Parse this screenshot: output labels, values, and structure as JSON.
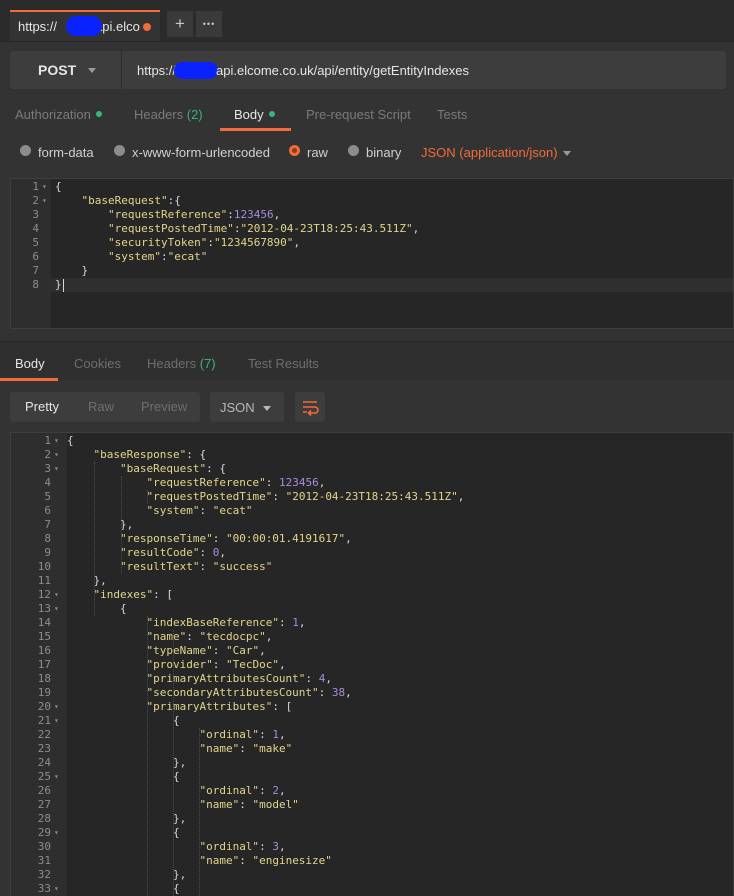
{
  "tab": {
    "title_prefix": "https://",
    "title_suffix": "api.elco",
    "new_tab": "+",
    "more": "•••"
  },
  "request": {
    "method": "POST",
    "url_prefix": "https://",
    "url_suffix": "api.elcome.co.uk/api/entity/getEntityIndexes"
  },
  "request_tabs": [
    {
      "label": "Authorization",
      "has_dot": true
    },
    {
      "label": "Headers",
      "count": "(2)"
    },
    {
      "label": "Body",
      "has_dot": true,
      "active": true
    },
    {
      "label": "Pre-request Script"
    },
    {
      "label": "Tests"
    }
  ],
  "body_options": {
    "modes": [
      "form-data",
      "x-www-form-urlencoded",
      "raw",
      "binary"
    ],
    "selected": "raw",
    "content_type": "JSON (application/json)"
  },
  "request_body": [
    [
      [
        "p",
        "{"
      ]
    ],
    [
      [
        "p",
        "    "
      ],
      [
        "k",
        "\"baseRequest\""
      ],
      [
        "p",
        ":{"
      ]
    ],
    [
      [
        "p",
        "        "
      ],
      [
        "k",
        "\"requestReference\""
      ],
      [
        "p",
        ":"
      ],
      [
        "n",
        "123456"
      ],
      [
        "p",
        ","
      ]
    ],
    [
      [
        "p",
        "        "
      ],
      [
        "k",
        "\"requestPostedTime\""
      ],
      [
        "p",
        ":"
      ],
      [
        "s",
        "\"2012-04-23T18:25:43.511Z\""
      ],
      [
        "p",
        ","
      ]
    ],
    [
      [
        "p",
        "        "
      ],
      [
        "k",
        "\"securityToken\""
      ],
      [
        "p",
        ":"
      ],
      [
        "s",
        "\"1234567890\""
      ],
      [
        "p",
        ","
      ]
    ],
    [
      [
        "p",
        "        "
      ],
      [
        "k",
        "\"system\""
      ],
      [
        "p",
        ":"
      ],
      [
        "s",
        "\"ecat\""
      ]
    ],
    [
      [
        "p",
        "    }"
      ]
    ],
    [
      [
        "p",
        "}"
      ]
    ]
  ],
  "request_folds": [
    1,
    2
  ],
  "response_tabs": [
    {
      "label": "Body",
      "active": true
    },
    {
      "label": "Cookies"
    },
    {
      "label": "Headers",
      "count": "(7)"
    },
    {
      "label": "Test Results"
    }
  ],
  "view_modes": [
    "Pretty",
    "Raw",
    "Preview"
  ],
  "view_selected": "Pretty",
  "format": "JSON",
  "response_body": [
    [
      [
        "p",
        "{"
      ]
    ],
    [
      [
        "p",
        "    "
      ],
      [
        "k",
        "\"baseResponse\""
      ],
      [
        "p",
        ": {"
      ]
    ],
    [
      [
        "p",
        "        "
      ],
      [
        "k",
        "\"baseRequest\""
      ],
      [
        "p",
        ": {"
      ]
    ],
    [
      [
        "p",
        "            "
      ],
      [
        "k",
        "\"requestReference\""
      ],
      [
        "p",
        ": "
      ],
      [
        "n",
        "123456"
      ],
      [
        "p",
        ","
      ]
    ],
    [
      [
        "p",
        "            "
      ],
      [
        "k",
        "\"requestPostedTime\""
      ],
      [
        "p",
        ": "
      ],
      [
        "s",
        "\"2012-04-23T18:25:43.511Z\""
      ],
      [
        "p",
        ","
      ]
    ],
    [
      [
        "p",
        "            "
      ],
      [
        "k",
        "\"system\""
      ],
      [
        "p",
        ": "
      ],
      [
        "s",
        "\"ecat\""
      ]
    ],
    [
      [
        "p",
        "        },"
      ]
    ],
    [
      [
        "p",
        "        "
      ],
      [
        "k",
        "\"responseTime\""
      ],
      [
        "p",
        ": "
      ],
      [
        "s",
        "\"00:00:01.4191617\""
      ],
      [
        "p",
        ","
      ]
    ],
    [
      [
        "p",
        "        "
      ],
      [
        "k",
        "\"resultCode\""
      ],
      [
        "p",
        ": "
      ],
      [
        "n",
        "0"
      ],
      [
        "p",
        ","
      ]
    ],
    [
      [
        "p",
        "        "
      ],
      [
        "k",
        "\"resultText\""
      ],
      [
        "p",
        ": "
      ],
      [
        "s",
        "\"success\""
      ]
    ],
    [
      [
        "p",
        "    },"
      ]
    ],
    [
      [
        "p",
        "    "
      ],
      [
        "k",
        "\"indexes\""
      ],
      [
        "p",
        ": ["
      ]
    ],
    [
      [
        "p",
        "        {"
      ]
    ],
    [
      [
        "p",
        "            "
      ],
      [
        "k",
        "\"indexBaseReference\""
      ],
      [
        "p",
        ": "
      ],
      [
        "n",
        "1"
      ],
      [
        "p",
        ","
      ]
    ],
    [
      [
        "p",
        "            "
      ],
      [
        "k",
        "\"name\""
      ],
      [
        "p",
        ": "
      ],
      [
        "s",
        "\"tecdocpc\""
      ],
      [
        "p",
        ","
      ]
    ],
    [
      [
        "p",
        "            "
      ],
      [
        "k",
        "\"typeName\""
      ],
      [
        "p",
        ": "
      ],
      [
        "s",
        "\"Car\""
      ],
      [
        "p",
        ","
      ]
    ],
    [
      [
        "p",
        "            "
      ],
      [
        "k",
        "\"provider\""
      ],
      [
        "p",
        ": "
      ],
      [
        "s",
        "\"TecDoc\""
      ],
      [
        "p",
        ","
      ]
    ],
    [
      [
        "p",
        "            "
      ],
      [
        "k",
        "\"primaryAttributesCount\""
      ],
      [
        "p",
        ": "
      ],
      [
        "n",
        "4"
      ],
      [
        "p",
        ","
      ]
    ],
    [
      [
        "p",
        "            "
      ],
      [
        "k",
        "\"secondaryAttributesCount\""
      ],
      [
        "p",
        ": "
      ],
      [
        "n",
        "38"
      ],
      [
        "p",
        ","
      ]
    ],
    [
      [
        "p",
        "            "
      ],
      [
        "k",
        "\"primaryAttributes\""
      ],
      [
        "p",
        ": ["
      ]
    ],
    [
      [
        "p",
        "                {"
      ]
    ],
    [
      [
        "p",
        "                    "
      ],
      [
        "k",
        "\"ordinal\""
      ],
      [
        "p",
        ": "
      ],
      [
        "n",
        "1"
      ],
      [
        "p",
        ","
      ]
    ],
    [
      [
        "p",
        "                    "
      ],
      [
        "k",
        "\"name\""
      ],
      [
        "p",
        ": "
      ],
      [
        "s",
        "\"make\""
      ]
    ],
    [
      [
        "p",
        "                },"
      ]
    ],
    [
      [
        "p",
        "                {"
      ]
    ],
    [
      [
        "p",
        "                    "
      ],
      [
        "k",
        "\"ordinal\""
      ],
      [
        "p",
        ": "
      ],
      [
        "n",
        "2"
      ],
      [
        "p",
        ","
      ]
    ],
    [
      [
        "p",
        "                    "
      ],
      [
        "k",
        "\"name\""
      ],
      [
        "p",
        ": "
      ],
      [
        "s",
        "\"model\""
      ]
    ],
    [
      [
        "p",
        "                },"
      ]
    ],
    [
      [
        "p",
        "                {"
      ]
    ],
    [
      [
        "p",
        "                    "
      ],
      [
        "k",
        "\"ordinal\""
      ],
      [
        "p",
        ": "
      ],
      [
        "n",
        "3"
      ],
      [
        "p",
        ","
      ]
    ],
    [
      [
        "p",
        "                    "
      ],
      [
        "k",
        "\"name\""
      ],
      [
        "p",
        ": "
      ],
      [
        "s",
        "\"enginesize\""
      ]
    ],
    [
      [
        "p",
        "                },"
      ]
    ],
    [
      [
        "p",
        "                {"
      ]
    ]
  ],
  "response_folds": [
    1,
    2,
    3,
    12,
    13,
    20,
    21,
    25,
    29,
    33
  ]
}
